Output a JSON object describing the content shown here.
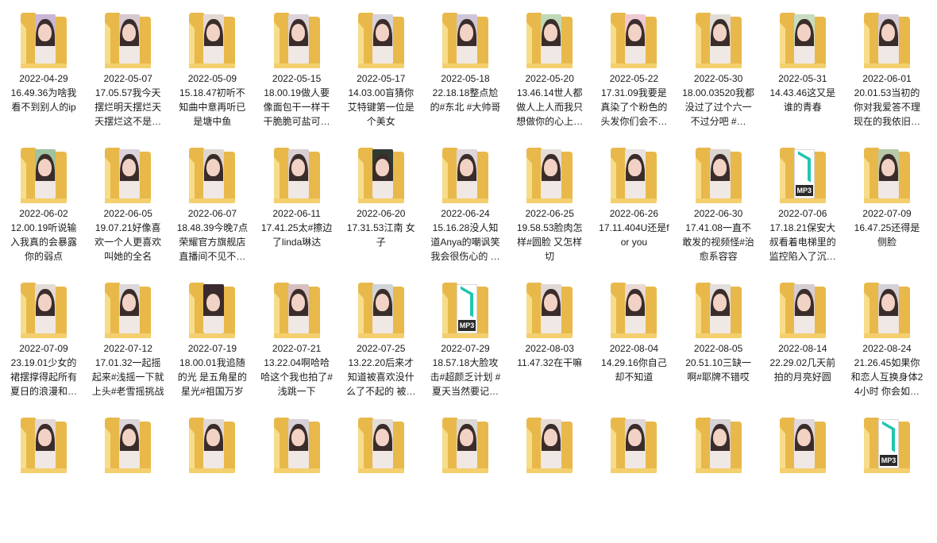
{
  "icons": {
    "folder": "folder-icon",
    "audio": "mp3-icon"
  },
  "colors": {
    "folder_front": "#f4cf6e",
    "folder_back": "#e8b94a",
    "mp3_accent": "#1fc6b0"
  },
  "folders": [
    {
      "date": "2022-04-29",
      "desc": "16.49.36为啥我看不到别人的ip",
      "thumb": "photo",
      "tint": "#c9b6d6"
    },
    {
      "date": "2022-05-07",
      "desc": "17.05.57我今天摆烂明天摆烂天天摆烂这不是…",
      "thumb": "photo",
      "tint": "#d8c8d0"
    },
    {
      "date": "2022-05-09",
      "desc": "15.18.47初听不知曲中意再听已是塘中鱼",
      "thumb": "photo",
      "tint": "#e4d8d2"
    },
    {
      "date": "2022-05-15",
      "desc": "18.00.19做人要像面包干一样干干脆脆可盐可…",
      "thumb": "photo",
      "tint": "#dcd4da"
    },
    {
      "date": "2022-05-17",
      "desc": "14.03.00盲猜你艾特键第一位是个美女",
      "thumb": "photo",
      "tint": "#d6d2dc"
    },
    {
      "date": "2022-05-18",
      "desc": "22.18.18整点尬的#东北 #大帅哥",
      "thumb": "photo",
      "tint": "#cfc6d8"
    },
    {
      "date": "2022-05-20",
      "desc": "13.46.14世人都做人上人而我只想做你的心上…",
      "thumb": "photo",
      "tint": "#bfd8b6"
    },
    {
      "date": "2022-05-22",
      "desc": "17.31.09我要是真染了个粉色的头发你们会不…",
      "thumb": "photo",
      "tint": "#f0c8d4"
    },
    {
      "date": "2022-05-30",
      "desc": "18.00.03520我都没过了过个六一不过分吧 #…",
      "thumb": "photo",
      "tint": "#e2dcd6"
    },
    {
      "date": "2022-05-31",
      "desc": "14.43.46这又是谁的青春",
      "thumb": "photo",
      "tint": "#c8dcc0"
    },
    {
      "date": "2022-06-01",
      "desc": "20.01.53当初的你对我爱答不理现在的我依旧…",
      "thumb": "photo",
      "tint": "#d4ccd8"
    },
    {
      "date": "2022-06-02",
      "desc": "12.00.19听说输入我真的会暴露你的弱点",
      "thumb": "photo",
      "tint": "#9fc2a0"
    },
    {
      "date": "2022-06-05",
      "desc": "19.07.21好像喜欢一个人更喜欢叫她的全名",
      "thumb": "photo",
      "tint": "#dcd4dc"
    },
    {
      "date": "2022-06-07",
      "desc": "18.48.39今晚7点荣耀官方旗舰店直播间不见不…",
      "thumb": "photo",
      "tint": "#e0d6d0"
    },
    {
      "date": "2022-06-11",
      "desc": "17.41.25太#擦边了linda琳达",
      "thumb": "photo",
      "tint": "#d8d0d4"
    },
    {
      "date": "2022-06-20",
      "desc": "17.31.53江南 女子",
      "thumb": "photo",
      "tint": "#2f3a33"
    },
    {
      "date": "2022-06-24",
      "desc": "15.16.28没人知道Anya的嘲讽笑我会很伤心的 …",
      "thumb": "photo",
      "tint": "#ded6da"
    },
    {
      "date": "2022-06-25",
      "desc": "19.58.53脸肉怎样#圆脸 又怎样 切",
      "thumb": "photo",
      "tint": "#e6dcd8"
    },
    {
      "date": "2022-06-26",
      "desc": "17.11.404U还是for you",
      "thumb": "photo",
      "tint": "#e8e2e0"
    },
    {
      "date": "2022-06-30",
      "desc": "17.41.08一直不敢发的视频怪#治愈系容容",
      "thumb": "photo",
      "tint": "#dcd4d0"
    },
    {
      "date": "2022-07-06",
      "desc": "17.18.21保安大叔看着电梯里的监控陷入了沉…",
      "thumb": "mp3",
      "tint": "#ffffff"
    },
    {
      "date": "2022-07-09",
      "desc": "16.47.25还得是侧脸",
      "thumb": "photo",
      "tint": "#b8c9a8"
    },
    {
      "date": "2022-07-09",
      "desc": "23.19.01少女的裙摆撑得起所有夏日的浪漫和…",
      "thumb": "photo",
      "tint": "#e4dcd4"
    },
    {
      "date": "2022-07-12",
      "desc": "17.01.32一起摇起来#浅摇一下就上头#老雪摇挑战",
      "thumb": "photo",
      "tint": "#dcd8dc"
    },
    {
      "date": "2022-07-19",
      "desc": "18.00.01我追随的光 是五角星的星光#祖国万岁",
      "thumb": "photo",
      "tint": "#3a2a30"
    },
    {
      "date": "2022-07-21",
      "desc": "13.22.04啊哈哈哈这个我也拍了#浅跳一下",
      "thumb": "photo",
      "tint": "#d8c0c0"
    },
    {
      "date": "2022-07-25",
      "desc": "13.22.20后来才知道被喜欢没什么了不起的 被…",
      "thumb": "photo",
      "tint": "#cfd4d8"
    },
    {
      "date": "2022-07-29",
      "desc": "18.57.18大脸攻击#超颜乏计划 #夏天当然要记…",
      "thumb": "mp3",
      "tint": "#ffffff"
    },
    {
      "date": "2022-08-03",
      "desc": "11.47.32在干嘛",
      "thumb": "photo",
      "tint": "#e0d8d6"
    },
    {
      "date": "2022-08-04",
      "desc": "14.29.16你自己却不知道",
      "thumb": "photo",
      "tint": "#ead8d2"
    },
    {
      "date": "2022-08-05",
      "desc": "20.51.10三缺一啊#耶牌不错哎",
      "thumb": "photo",
      "tint": "#e4dedc"
    },
    {
      "date": "2022-08-14",
      "desc": "22.29.02几天前拍的月亮好圆",
      "thumb": "photo",
      "tint": "#d6ccd4"
    },
    {
      "date": "2022-08-24",
      "desc": "21.26.45如果你和恋人互换身体24小时 你会如…",
      "thumb": "photo",
      "tint": "#d4d2d8"
    },
    {
      "date": "",
      "desc": "",
      "thumb": "photo",
      "tint": "#e2d8d6"
    },
    {
      "date": "",
      "desc": "",
      "thumb": "photo",
      "tint": "#dcd6da"
    },
    {
      "date": "",
      "desc": "",
      "thumb": "photo",
      "tint": "#e0d8d4"
    },
    {
      "date": "",
      "desc": "",
      "thumb": "photo",
      "tint": "#d6d0d8"
    },
    {
      "date": "",
      "desc": "",
      "thumb": "photo",
      "tint": "#e4dcd8"
    },
    {
      "date": "",
      "desc": "",
      "thumb": "photo",
      "tint": "#dcd8d4"
    },
    {
      "date": "",
      "desc": "",
      "thumb": "photo",
      "tint": "#e6dcd6"
    },
    {
      "date": "",
      "desc": "",
      "thumb": "photo",
      "tint": "#ded6d8"
    },
    {
      "date": "",
      "desc": "",
      "thumb": "photo",
      "tint": "#d8d2d6"
    },
    {
      "date": "",
      "desc": "",
      "thumb": "photo",
      "tint": "#e0d8dc"
    },
    {
      "date": "",
      "desc": "",
      "thumb": "mp3",
      "tint": "#ffffff"
    }
  ]
}
